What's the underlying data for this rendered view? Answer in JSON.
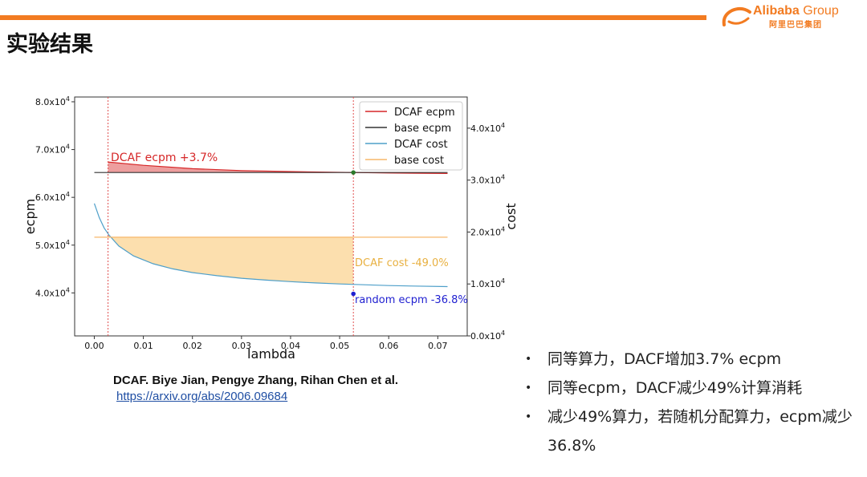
{
  "slide": {
    "title": "实验结果"
  },
  "logo": {
    "name_en": "Alibaba",
    "group": "Group",
    "name_cn": "阿里巴巴集团"
  },
  "colors": {
    "accent": "#f27b21",
    "dcaf_ecpm": "#d62728",
    "base_ecpm": "#333333",
    "dcaf_cost": "#4e9fc9",
    "base_cost": "#f7b76a",
    "random": "#1f1fd0",
    "vline": "#e05050"
  },
  "chart_data": {
    "type": "line",
    "xlabel": "lambda",
    "ylabel": "ecpm",
    "y2label": "cost",
    "xlim": [
      -0.004,
      0.076
    ],
    "ylim": [
      31000,
      81000
    ],
    "y2lim": [
      0,
      46000
    ],
    "xticks": [
      0.0,
      0.01,
      0.02,
      0.03,
      0.04,
      0.05,
      0.06,
      0.07
    ],
    "xtick_labels": [
      "0.00",
      "0.01",
      "0.02",
      "0.03",
      "0.04",
      "0.05",
      "0.06",
      "0.07"
    ],
    "yticks": [
      40000,
      50000,
      60000,
      70000,
      80000
    ],
    "ytick_labels": [
      {
        "base": "4.0x10",
        "exp": "4"
      },
      {
        "base": "5.0x10",
        "exp": "4"
      },
      {
        "base": "6.0x10",
        "exp": "4"
      },
      {
        "base": "7.0x10",
        "exp": "4"
      },
      {
        "base": "8.0x10",
        "exp": "4"
      }
    ],
    "y2ticks": [
      0,
      10000,
      20000,
      30000,
      40000
    ],
    "y2tick_labels": [
      {
        "base": "0.0x10",
        "exp": "4"
      },
      {
        "base": "1.0x10",
        "exp": "4"
      },
      {
        "base": "2.0x10",
        "exp": "4"
      },
      {
        "base": "3.0x10",
        "exp": "4"
      },
      {
        "base": "4.0x10",
        "exp": "4"
      }
    ],
    "vlines": [
      0.0028,
      0.0528
    ],
    "series": [
      {
        "name": "DCAF ecpm",
        "axis": "left",
        "x": [
          0.0028,
          0.01,
          0.02,
          0.03,
          0.04,
          0.0528,
          0.06,
          0.072
        ],
        "y": [
          67400,
          66700,
          66000,
          65600,
          65400,
          65200,
          65100,
          65000
        ]
      },
      {
        "name": "base ecpm",
        "axis": "left",
        "x": [
          0.0,
          0.072
        ],
        "y": [
          65200,
          65200
        ]
      },
      {
        "name": "DCAF cost",
        "axis": "right",
        "x": [
          0.0,
          0.001,
          0.002,
          0.003,
          0.005,
          0.008,
          0.012,
          0.016,
          0.02,
          0.025,
          0.03,
          0.035,
          0.04,
          0.045,
          0.05,
          0.055,
          0.06,
          0.065,
          0.072
        ],
        "y": [
          25500,
          22800,
          20800,
          19400,
          17300,
          15400,
          13900,
          12900,
          12200,
          11600,
          11100,
          10750,
          10450,
          10200,
          10000,
          9850,
          9700,
          9600,
          9500
        ]
      },
      {
        "name": "base cost",
        "axis": "right",
        "x": [
          0.0,
          0.072
        ],
        "y": [
          19000,
          19000
        ]
      }
    ],
    "legend_position": "top-right",
    "points": [
      {
        "x": 0.0528,
        "y": 65200,
        "axis": "left",
        "color": "#2a7a2a"
      },
      {
        "x": 0.0528,
        "y": 8100,
        "axis": "right",
        "color": "#1f1fd0"
      }
    ],
    "annotations": [
      {
        "text": "DCAF ecpm +3.7%",
        "color": "#d62728"
      },
      {
        "text": "DCAF cost -49.0%",
        "color": "#e8b040"
      },
      {
        "text": "random ecpm -36.8%",
        "color": "#1f1fd0"
      }
    ]
  },
  "reference": {
    "citation": "DCAF. Biye Jian, Pengye Zhang, Rihan Chen et al.",
    "link": "https://arxiv.org/abs/2006.09684"
  },
  "bullets": [
    {
      "marker": "•",
      "text": "同等算力，DACF增加3.7% ecpm"
    },
    {
      "marker": "•",
      "text": "同等ecpm，DACF减少49%计算消耗"
    },
    {
      "marker": "•",
      "text": "减少49%算力，若随机分配算力，ecpm减少36.8%"
    }
  ]
}
